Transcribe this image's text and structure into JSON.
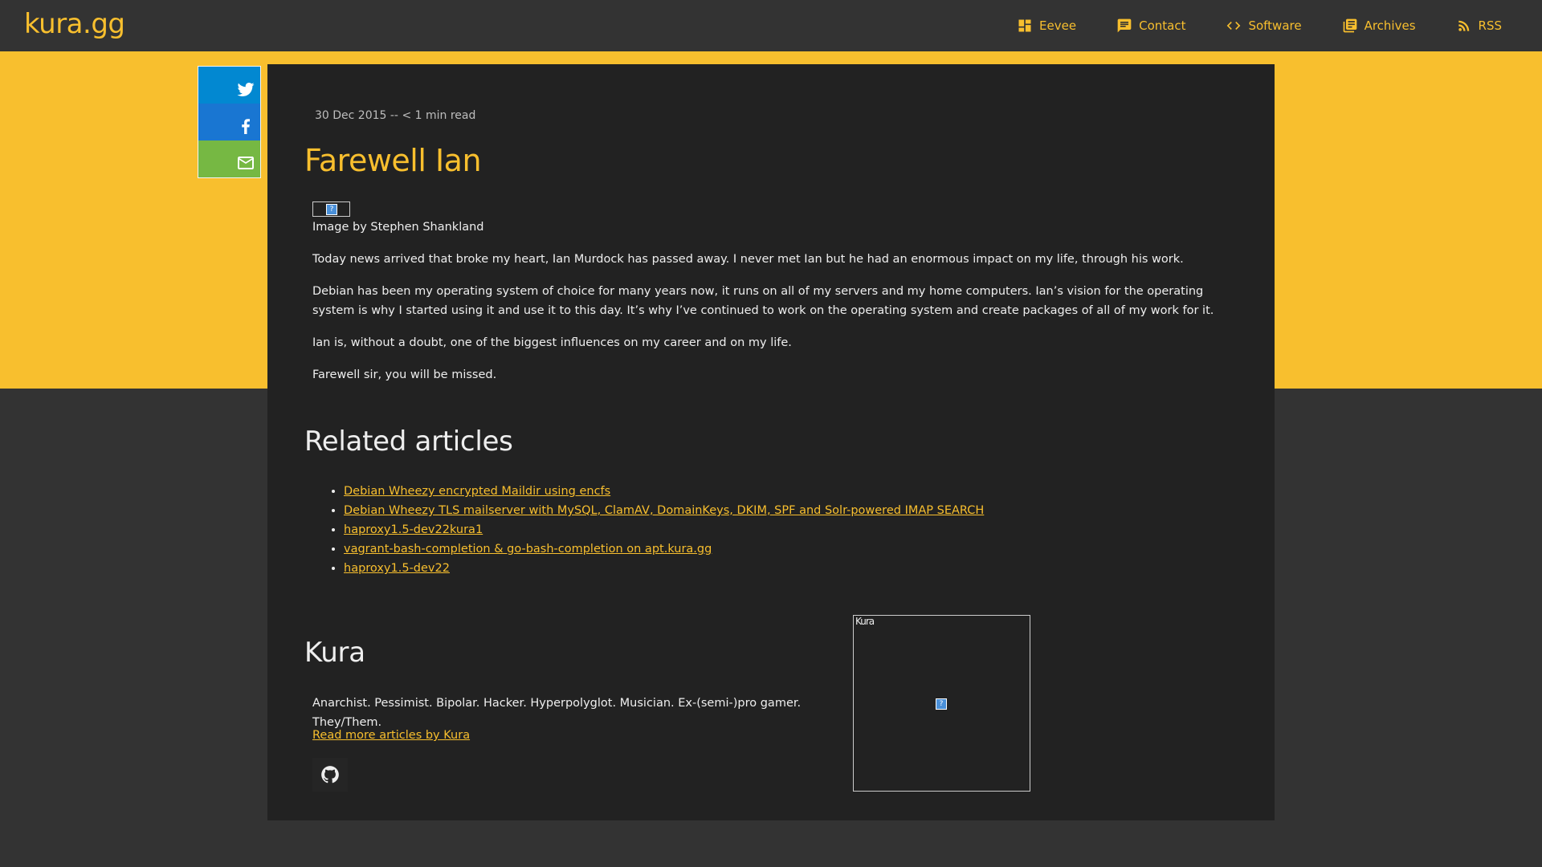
{
  "site": {
    "logo": "kura.gg"
  },
  "nav": [
    {
      "label": "Eevee",
      "icon": "dashboard-icon"
    },
    {
      "label": "Contact",
      "icon": "chat-icon"
    },
    {
      "label": "Software",
      "icon": "code-icon"
    },
    {
      "label": "Archives",
      "icon": "library-icon"
    },
    {
      "label": "RSS",
      "icon": "rss-icon"
    }
  ],
  "share": [
    {
      "network": "twitter",
      "icon": "twitter-icon",
      "color": "#0288d1"
    },
    {
      "network": "facebook",
      "icon": "facebook-icon",
      "color": "#1976d2"
    },
    {
      "network": "email",
      "icon": "mail-icon",
      "color": "#76b843"
    }
  ],
  "post": {
    "meta": "30 Dec 2015 -- < 1 min read",
    "title": "Farewell Ian",
    "image_credit": "Image by Stephen Shankland",
    "paragraphs": [
      "Today news arrived that broke my heart, Ian Murdock has passed away. I never met Ian but he had an enormous impact on my life, through his work.",
      "Debian has been my operating system of choice for many years now, it runs on all of my servers and my home computers. Ian’s vision for the operating system is why I started using it and use it to this day. It’s why I’ve continued to work on the operating system and create packages of all of my work for it.",
      "Ian is, without a doubt, one of the biggest influences on my career and on my life.",
      "Farewell sir, you will be missed."
    ]
  },
  "related": {
    "heading": "Related articles",
    "items": [
      "Debian Wheezy encrypted Maildir using encfs",
      "Debian Wheezy TLS mailserver with MySQL, ClamAV, DomainKeys, DKIM, SPF and Solr-powered IMAP SEARCH",
      "haproxy1.5-dev22kura1",
      "vagrant-bash-completion & go-bash-completion on apt.kura.gg",
      "haproxy1.5-dev22"
    ]
  },
  "author": {
    "name": "Kura",
    "bio": "Anarchist. Pessimist. Bipolar. Hacker. Hyperpolyglot. Musician. Ex-(semi-)pro gamer. They/Them.",
    "more_link": "Read more articles by Kura",
    "avatar_alt": "Kura",
    "social_icon": "github-icon"
  },
  "colors": {
    "accent": "#f8bf2e",
    "background": "#333333",
    "card": "#222222"
  }
}
